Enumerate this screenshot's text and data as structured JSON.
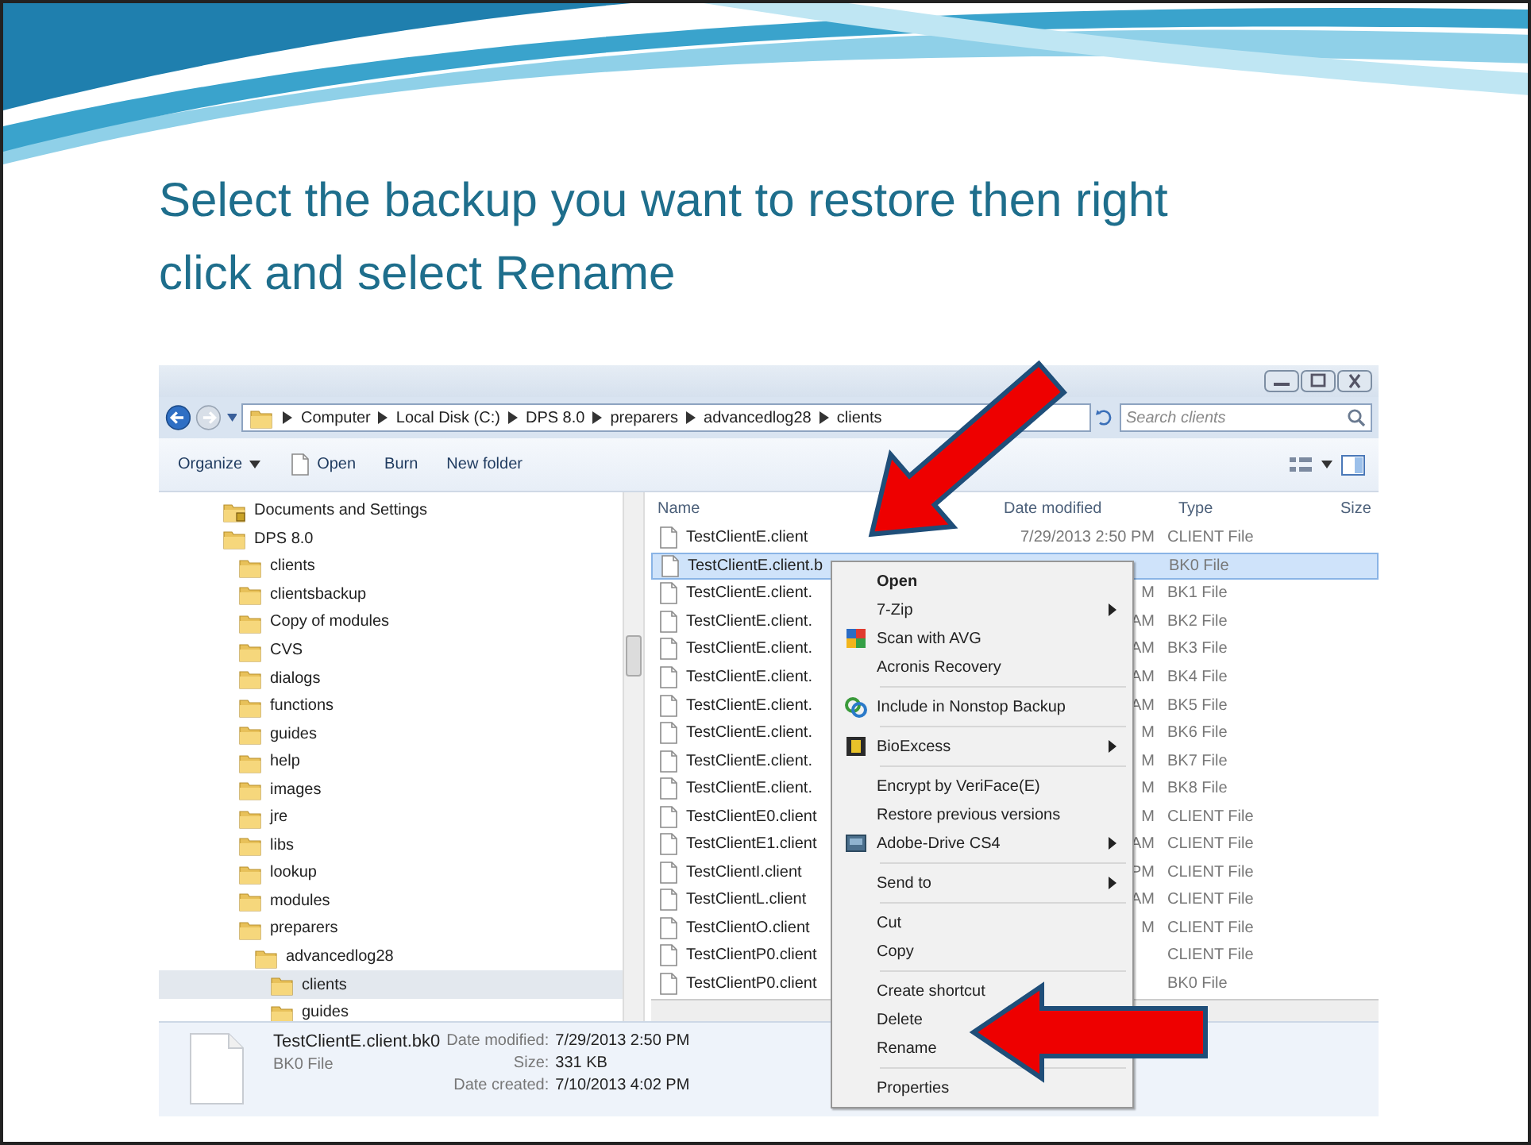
{
  "slide": {
    "title": "Select the backup you want to restore then right click and select Rename"
  },
  "explorer": {
    "breadcrumb": [
      "Computer",
      "Local Disk (C:)",
      "DPS 8.0",
      "preparers",
      "advancedlog28",
      "clients"
    ],
    "search": {
      "placeholder": "Search clients"
    },
    "toolbar": [
      {
        "label": "Organize",
        "kind": "menu"
      },
      {
        "label": "Open",
        "kind": "file"
      },
      {
        "label": "Burn",
        "kind": "plain"
      },
      {
        "label": "New folder",
        "kind": "plain"
      }
    ],
    "tree": [
      {
        "label": "Documents and Settings",
        "kind": "locked",
        "selected": false
      },
      {
        "label": "DPS 8.0",
        "kind": "folder",
        "selected": false,
        "children": [
          {
            "label": "clients",
            "kind": "folder",
            "selected": false
          },
          {
            "label": "clientsbackup",
            "kind": "folder",
            "selected": false
          },
          {
            "label": "Copy of modules",
            "kind": "folder",
            "selected": false
          },
          {
            "label": "CVS",
            "kind": "folder",
            "selected": false
          },
          {
            "label": "dialogs",
            "kind": "folder",
            "selected": false
          },
          {
            "label": "functions",
            "kind": "folder",
            "selected": false
          },
          {
            "label": "guides",
            "kind": "folder",
            "selected": false
          },
          {
            "label": "help",
            "kind": "folder",
            "selected": false
          },
          {
            "label": "images",
            "kind": "folder",
            "selected": false
          },
          {
            "label": "jre",
            "kind": "folder",
            "selected": false
          },
          {
            "label": "libs",
            "kind": "folder",
            "selected": false
          },
          {
            "label": "lookup",
            "kind": "folder",
            "selected": false
          },
          {
            "label": "modules",
            "kind": "folder",
            "selected": false
          },
          {
            "label": "preparers",
            "kind": "folder",
            "selected": false,
            "children": [
              {
                "label": "advancedlog28",
                "kind": "folder",
                "selected": false,
                "children": [
                  {
                    "label": "clients",
                    "kind": "folder",
                    "selected": true
                  },
                  {
                    "label": "guides",
                    "kind": "folder",
                    "selected": false
                  }
                ]
              }
            ]
          }
        ]
      }
    ],
    "columns": [
      "Name",
      "Date modified",
      "Type",
      "Size"
    ],
    "files": [
      {
        "name": "TestClientE.client",
        "date": "7/29/2013 2:50 PM",
        "type": "CLIENT File",
        "selected": false
      },
      {
        "name": "TestClientE.client.b",
        "type": "BK0 File",
        "selected": true
      },
      {
        "name": "TestClientE.client.",
        "date": "M",
        "type": "BK1 File",
        "selected": false
      },
      {
        "name": "TestClientE.client.",
        "date": "AM",
        "type": "BK2 File",
        "selected": false
      },
      {
        "name": "TestClientE.client.",
        "date": "AM",
        "type": "BK3 File",
        "selected": false
      },
      {
        "name": "TestClientE.client.",
        "date": "AM",
        "type": "BK4 File",
        "selected": false
      },
      {
        "name": "TestClientE.client.",
        "date": "AM",
        "type": "BK5 File",
        "selected": false
      },
      {
        "name": "TestClientE.client.",
        "date": "M",
        "type": "BK6 File",
        "selected": false
      },
      {
        "name": "TestClientE.client.",
        "date": "M",
        "type": "BK7 File",
        "selected": false
      },
      {
        "name": "TestClientE.client.",
        "date": "M",
        "type": "BK8 File",
        "selected": false
      },
      {
        "name": "TestClientE0.client",
        "date": "M",
        "type": "CLIENT File",
        "selected": false
      },
      {
        "name": "TestClientE1.client",
        "date": "AM",
        "type": "CLIENT File",
        "selected": false
      },
      {
        "name": "TestClientI.client",
        "date": "PM",
        "type": "CLIENT File",
        "selected": false
      },
      {
        "name": "TestClientL.client",
        "date": "AM",
        "type": "CLIENT File",
        "selected": false
      },
      {
        "name": "TestClientO.client",
        "date": "M",
        "type": "CLIENT File",
        "selected": false
      },
      {
        "name": "TestClientP0.client",
        "type": "CLIENT File",
        "selected": false
      },
      {
        "name": "TestClientP0.client",
        "type": "BK0 File",
        "selected": false
      }
    ],
    "context_menu": [
      {
        "kind": "text",
        "label": "Open",
        "default": true,
        "submenu": false
      },
      {
        "kind": "text",
        "label": "7-Zip",
        "default": false,
        "submenu": true
      },
      {
        "kind": "scan",
        "label": "Scan with AVG",
        "default": false,
        "submenu": false
      },
      {
        "kind": "text",
        "label": "Acronis Recovery",
        "default": false,
        "submenu": false
      },
      {
        "kind": "separator"
      },
      {
        "kind": "sync",
        "label": "Include in Nonstop Backup",
        "default": false,
        "submenu": false
      },
      {
        "kind": "separator"
      },
      {
        "kind": "bio",
        "label": "BioExcess",
        "default": false,
        "submenu": true
      },
      {
        "kind": "separator"
      },
      {
        "kind": "text",
        "label": "Encrypt by VeriFace(E)",
        "default": false,
        "submenu": false
      },
      {
        "kind": "text",
        "label": "Restore previous versions",
        "default": false,
        "submenu": false
      },
      {
        "kind": "drive",
        "label": "Adobe-Drive CS4",
        "default": false,
        "submenu": true
      },
      {
        "kind": "separator"
      },
      {
        "kind": "text",
        "label": "Send to",
        "default": false,
        "submenu": true
      },
      {
        "kind": "separator"
      },
      {
        "kind": "text",
        "label": "Cut",
        "default": false,
        "submenu": false
      },
      {
        "kind": "text",
        "label": "Copy",
        "default": false,
        "submenu": false
      },
      {
        "kind": "separator"
      },
      {
        "kind": "text",
        "label": "Create shortcut",
        "default": false,
        "submenu": false
      },
      {
        "kind": "text",
        "label": "Delete",
        "default": false,
        "submenu": false
      },
      {
        "kind": "text",
        "label": "Rename",
        "default": false,
        "submenu": false
      },
      {
        "kind": "separator"
      },
      {
        "kind": "text",
        "label": "Properties",
        "default": false,
        "submenu": false
      }
    ],
    "details": {
      "name": "TestClientE.client.bk0",
      "type": "BK0 File",
      "fields": [
        {
          "label": "Date modified:",
          "value": "7/29/2013 2:50 PM"
        },
        {
          "label": "Size:",
          "value": "331 KB"
        },
        {
          "label": "Date created:",
          "value": "7/10/2013 4:02 PM"
        }
      ]
    }
  }
}
